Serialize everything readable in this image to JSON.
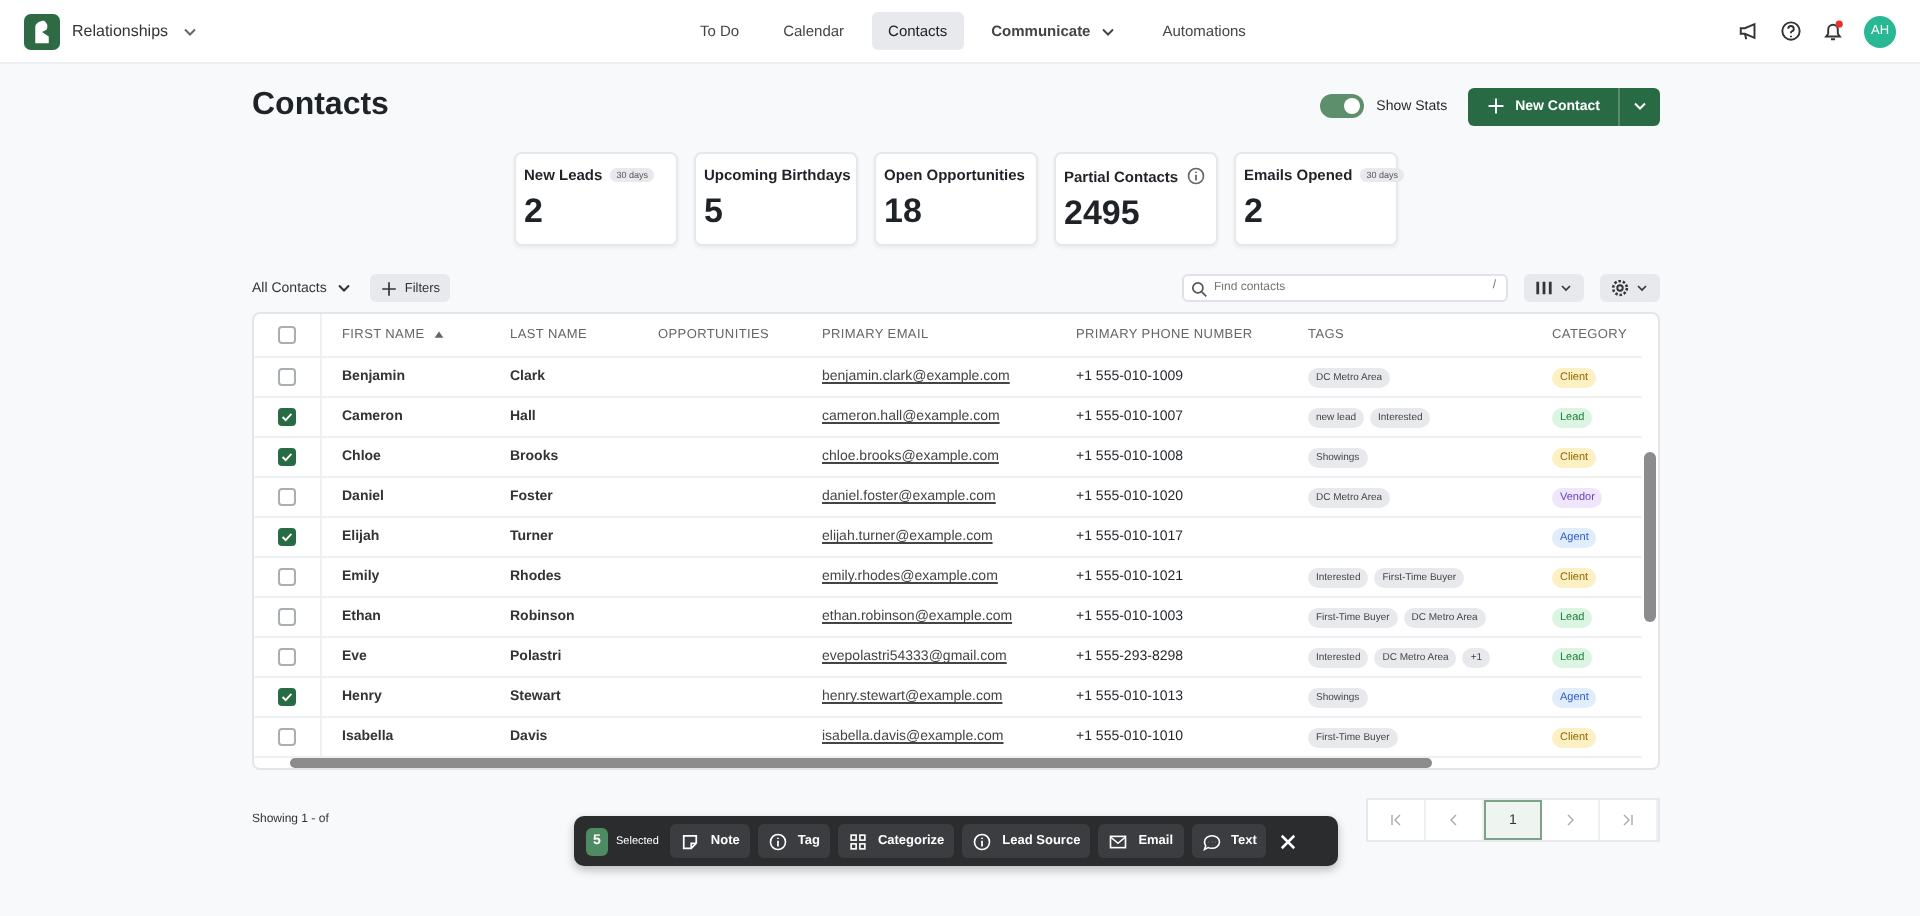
{
  "app": {
    "name": "Relationships"
  },
  "nav": [
    {
      "label": "To Do",
      "selected": false,
      "dropdown": false
    },
    {
      "label": "Calendar",
      "selected": false,
      "dropdown": false
    },
    {
      "label": "Contacts",
      "selected": true,
      "dropdown": false
    },
    {
      "label": "Communicate",
      "selected": false,
      "dropdown": true
    },
    {
      "label": "Automations",
      "selected": false,
      "dropdown": false
    }
  ],
  "user": {
    "initials": "AH",
    "notifications": true
  },
  "page": {
    "title": "Contacts",
    "show_stats": {
      "label": "Show Stats",
      "on": true
    },
    "new_button": "New Contact"
  },
  "stats": [
    {
      "label": "New Leads",
      "badge": "30 days",
      "info": false,
      "value": "2"
    },
    {
      "label": "Upcoming Birthdays",
      "info": false,
      "value": "5"
    },
    {
      "label": "Open Opportunities",
      "info": false,
      "value": "18"
    },
    {
      "label": "Partial Contacts",
      "info": true,
      "value": "2495"
    },
    {
      "label": "Emails Opened",
      "badge": "30 days",
      "info": false,
      "value": "2"
    }
  ],
  "toolbar": {
    "view": "All Contacts",
    "filters": "Filters",
    "search": {
      "placeholder": "Find contacts",
      "shortcut": "/"
    }
  },
  "table": {
    "all_checked": false,
    "columns": [
      {
        "label": "FIRST NAME",
        "sorted": true
      },
      {
        "label": "LAST NAME",
        "sorted": false
      },
      {
        "label": "OPPORTUNITIES",
        "sorted": false
      },
      {
        "label": "PRIMARY EMAIL",
        "sorted": false
      },
      {
        "label": "PRIMARY PHONE NUMBER",
        "sorted": false
      },
      {
        "label": "TAGS",
        "sorted": false
      },
      {
        "label": "CATEGORY",
        "sorted": false
      }
    ],
    "rows": [
      {
        "checked": false,
        "first": "Benjamin",
        "last": "Clark",
        "email": "benjamin.clark@example.com",
        "phone": "+1 555-010-1009",
        "tags": [
          "DC Metro Area"
        ],
        "category": {
          "label": "Client",
          "kind": "client"
        }
      },
      {
        "checked": true,
        "first": "Cameron",
        "last": "Hall",
        "email": "cameron.hall@example.com",
        "phone": "+1 555-010-1007",
        "tags": [
          "new lead",
          "Interested"
        ],
        "category": {
          "label": "Lead",
          "kind": "lead"
        }
      },
      {
        "checked": true,
        "first": "Chloe",
        "last": "Brooks",
        "email": "chloe.brooks@example.com",
        "phone": "+1 555-010-1008",
        "tags": [
          "Showings"
        ],
        "category": {
          "label": "Client",
          "kind": "client"
        }
      },
      {
        "checked": false,
        "first": "Daniel",
        "last": "Foster",
        "email": "daniel.foster@example.com",
        "phone": "+1 555-010-1020",
        "tags": [
          "DC Metro Area"
        ],
        "category": {
          "label": "Vendor",
          "kind": "vendor"
        }
      },
      {
        "checked": true,
        "first": "Elijah",
        "last": "Turner",
        "email": "elijah.turner@example.com",
        "phone": "+1 555-010-1017",
        "tags": [],
        "category": {
          "label": "Agent",
          "kind": "agent"
        }
      },
      {
        "checked": false,
        "first": "Emily",
        "last": "Rhodes",
        "email": "emily.rhodes@example.com",
        "phone": "+1 555-010-1021",
        "tags": [
          "Interested",
          "First-Time Buyer"
        ],
        "category": {
          "label": "Client",
          "kind": "client"
        }
      },
      {
        "checked": false,
        "first": "Ethan",
        "last": "Robinson",
        "email": "ethan.robinson@example.com",
        "phone": "+1 555-010-1003",
        "tags": [
          "First-Time Buyer",
          "DC Metro Area"
        ],
        "category": {
          "label": "Lead",
          "kind": "lead"
        }
      },
      {
        "checked": false,
        "first": "Eve",
        "last": "Polastri",
        "email": "evepolastri54333@gmail.com",
        "phone": "+1 555-293-8298",
        "tags": [
          "Interested",
          "DC Metro Area",
          "+1"
        ],
        "category": {
          "label": "Lead",
          "kind": "lead"
        }
      },
      {
        "checked": true,
        "first": "Henry",
        "last": "Stewart",
        "email": "henry.stewart@example.com",
        "phone": "+1 555-010-1013",
        "tags": [
          "Showings"
        ],
        "category": {
          "label": "Agent",
          "kind": "agent"
        }
      },
      {
        "checked": false,
        "first": "Isabella",
        "last": "Davis",
        "email": "isabella.davis@example.com",
        "phone": "+1 555-010-1010",
        "tags": [
          "First-Time Buyer"
        ],
        "category": {
          "label": "Client",
          "kind": "client"
        }
      }
    ]
  },
  "footer": {
    "showing": "Showing 1 - of",
    "pages": [
      {
        "label": "1",
        "selected": true
      }
    ]
  },
  "bulk": {
    "count": "5",
    "label": "Selected",
    "actions": [
      {
        "label": "Note",
        "kind": "note"
      },
      {
        "label": "Tag",
        "kind": "info"
      },
      {
        "label": "Categorize",
        "kind": "grid"
      },
      {
        "label": "Lead Source",
        "kind": "info"
      },
      {
        "label": "Email",
        "kind": "mail"
      },
      {
        "label": "Text",
        "kind": "chat"
      }
    ]
  }
}
